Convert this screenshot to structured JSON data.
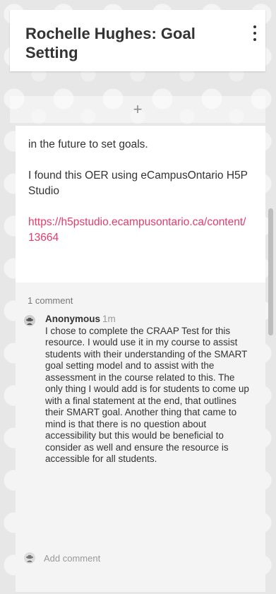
{
  "post": {
    "title": "Rochelle Hughes: Goal Setting",
    "add_post_label": "+",
    "body_paragraphs": [
      "in the future to set goals.",
      "I found this OER using eCampusOntario H5P Studio"
    ],
    "link_text": "https://h5pstudio.ecampusontario.ca/content/13664"
  },
  "comments": {
    "count_label": "1 comment",
    "items": [
      {
        "author": "Anonymous",
        "time": "1m",
        "text": "I chose to complete the CRAAP Test for this resource. I would use it in my course to assist students with their understanding of the SMART goal setting model and to assist with the assessment in the course related to this. The only thing I would add is for students to come up with a final statement at the end, that outlines their SMART goal. Another thing that came to mind is that there is no question about accessibility but this would be beneficial to consider as well and ensure the resource is accessible for all students."
      }
    ],
    "add_comment_placeholder": "Add comment"
  },
  "colors": {
    "link": "#e53b6a",
    "background": "#e7e7e7"
  },
  "icons": {
    "menu": "more-vertical-icon",
    "avatar": "anonymous-avatar-icon"
  }
}
